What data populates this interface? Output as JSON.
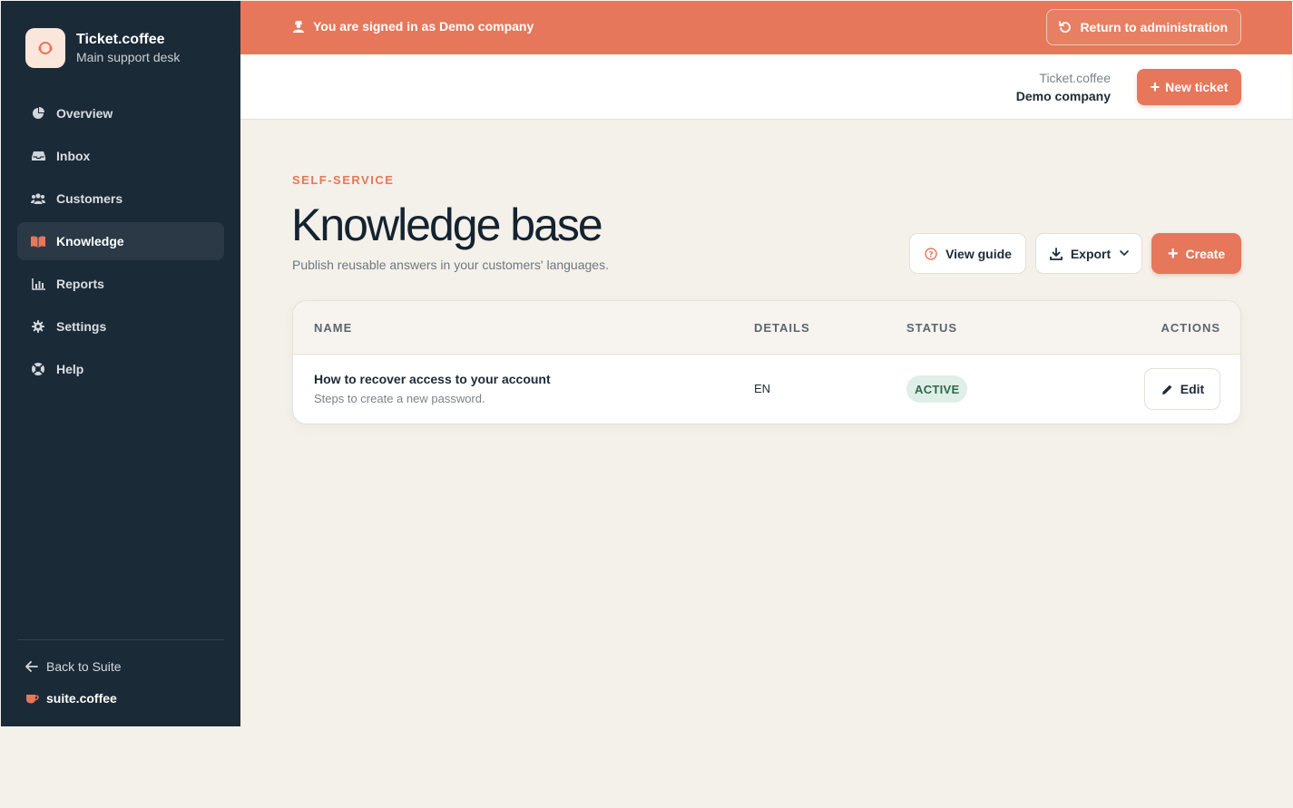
{
  "brand": {
    "title": "Ticket.coffee",
    "subtitle": "Main support desk"
  },
  "sidebar": {
    "items": [
      {
        "label": "Overview",
        "icon": "chart-pie-icon"
      },
      {
        "label": "Inbox",
        "icon": "inbox-icon"
      },
      {
        "label": "Customers",
        "icon": "users-icon"
      },
      {
        "label": "Knowledge",
        "icon": "book-icon",
        "active": true
      },
      {
        "label": "Reports",
        "icon": "bar-chart-icon"
      },
      {
        "label": "Settings",
        "icon": "gear-icon"
      },
      {
        "label": "Help",
        "icon": "lifebuoy-icon"
      }
    ],
    "back_label": "Back to Suite",
    "suite_label": "suite.coffee"
  },
  "banner": {
    "text": "You are signed in as Demo company",
    "return_label": "Return to administration"
  },
  "topbar": {
    "app_name": "Ticket.coffee",
    "company": "Demo company",
    "new_ticket_label": "New ticket"
  },
  "page": {
    "eyebrow": "SELF-SERVICE",
    "title": "Knowledge base",
    "description": "Publish reusable answers in your customers' languages."
  },
  "actions": {
    "view_guide": "View guide",
    "export": "Export",
    "create": "Create"
  },
  "table": {
    "headers": {
      "name": "NAME",
      "details": "DETAILS",
      "status": "STATUS",
      "actions": "ACTIONS"
    },
    "rows": [
      {
        "title": "How to recover access to your account",
        "subtitle": "Steps to create a new password.",
        "details": "EN",
        "status": "ACTIVE",
        "action": "Edit"
      }
    ]
  },
  "colors": {
    "accent": "#e6775a",
    "sidebar": "#1b2a37",
    "background": "#f4f0ea",
    "status_active_bg": "#dfeee6"
  }
}
